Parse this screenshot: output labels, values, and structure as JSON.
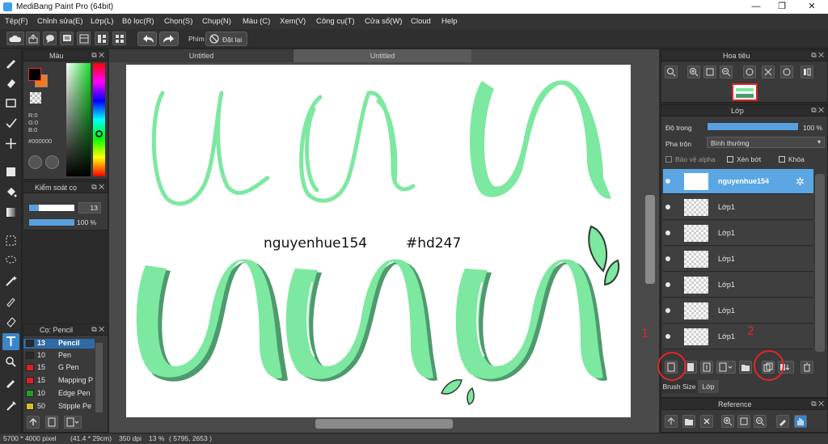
{
  "window": {
    "title": "MediBang Paint Pro (64bit)",
    "controls": [
      "minimize",
      "maximize",
      "close"
    ]
  },
  "menu": [
    "Tệp(F)",
    "Chỉnh sửa(E)",
    "Lớp(L)",
    "Bộ lọc(R)",
    "Chọn(S)",
    "Chụp(N)",
    "Màu (C)",
    "Xem(V)",
    "Công cụ(T)",
    "Cửa sổ(W)",
    "Cloud",
    "Help"
  ],
  "toolbar": {
    "shortcut_label": "Phím",
    "reset_label": "Đặt lại"
  },
  "doc_tabs": [
    "Untitled",
    "Untitled"
  ],
  "color_panel": {
    "title": "Màu",
    "r": "R:0",
    "g": "G:0",
    "b": "B:0",
    "hex": "#000000"
  },
  "brush_control": {
    "title": "Kiểm soát cọ",
    "size_value": "13",
    "opacity_value": "100 %"
  },
  "brush_panel": {
    "title": "Cọ: Pencil",
    "brushes": [
      {
        "size": "13",
        "name": "Pencil",
        "color": "#2a2a2a",
        "selected": true
      },
      {
        "size": "10",
        "name": "Pen",
        "color": "#2a2a2a",
        "selected": false
      },
      {
        "size": "15",
        "name": "G Pen",
        "color": "#e02020",
        "selected": false
      },
      {
        "size": "15",
        "name": "Mapping P",
        "color": "#e02020",
        "selected": false
      },
      {
        "size": "10",
        "name": "Edge Pen",
        "color": "#20a020",
        "selected": false
      },
      {
        "size": "50",
        "name": "Stipple Pe",
        "color": "#d8c020",
        "selected": false
      }
    ]
  },
  "canvas": {
    "text_author": "nguyenhue154",
    "text_tag": "#hd247",
    "ink_color": "#7de8a0",
    "shadow_color": "#4e9a6e"
  },
  "navigator": {
    "title": "Hoa tiêu"
  },
  "layer_panel": {
    "title": "Lớp",
    "opacity_label": "Độ trong",
    "opacity_value": "100 %",
    "blend_label": "Pha trộn",
    "blend_value": "Bình thường",
    "protect_alpha": "Bảo vệ alpha",
    "clipping": "Xén bớt",
    "lock": "Khóa",
    "layers": [
      {
        "name": "nguyenhue154",
        "selected": true
      },
      {
        "name": "Lớp1",
        "selected": false
      },
      {
        "name": "Lớp1",
        "selected": false
      },
      {
        "name": "Lớp1",
        "selected": false
      },
      {
        "name": "Lớp1",
        "selected": false
      },
      {
        "name": "Lớp1",
        "selected": false
      },
      {
        "name": "Lớp1",
        "selected": false
      }
    ],
    "tabs": [
      "Brush Size",
      "Lớp"
    ]
  },
  "reference_panel": {
    "title": "Reference"
  },
  "annotations": {
    "mark1": "1",
    "mark2": "2",
    "color": "#e32626"
  },
  "status": {
    "size": "5700 * 4000 pixel",
    "physical": "(41.4 * 29cm)",
    "dpi": "350 dpi",
    "zoom": "13 %",
    "coords": "( 5795, 2653 )"
  }
}
